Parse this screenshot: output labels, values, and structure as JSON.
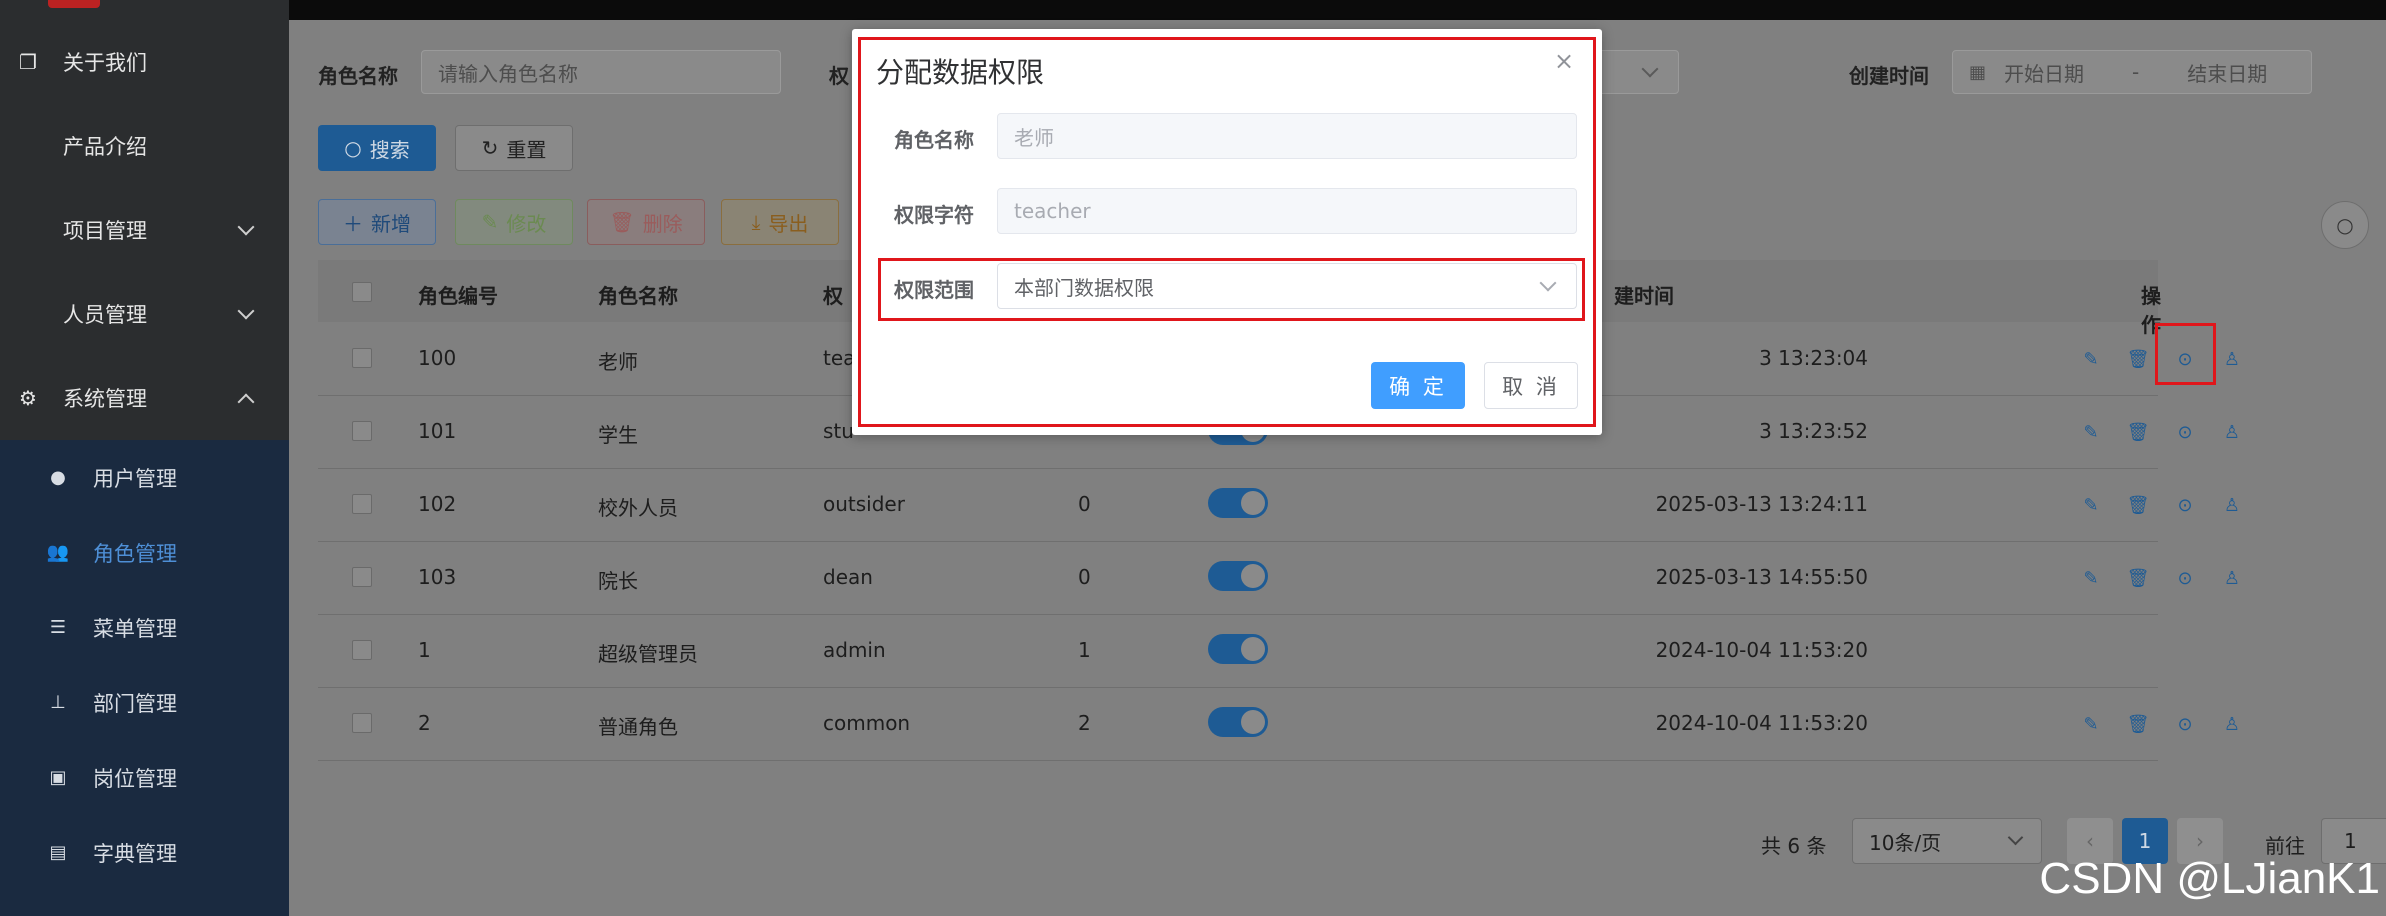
{
  "sidebar": {
    "items": [
      {
        "label": "关于我们",
        "icon": "file-copy-icon"
      },
      {
        "label": "产品介绍",
        "icon": ""
      },
      {
        "label": "项目管理",
        "icon": "",
        "expandable": true
      },
      {
        "label": "人员管理",
        "icon": "",
        "expandable": true
      },
      {
        "label": "系统管理",
        "icon": "gear-icon",
        "expandable": true,
        "expanded": true
      }
    ],
    "sub_items": [
      {
        "label": "用户管理",
        "icon": "user-icon"
      },
      {
        "label": "角色管理",
        "icon": "users-icon",
        "active": true
      },
      {
        "label": "菜单管理",
        "icon": "tree-list-icon"
      },
      {
        "label": "部门管理",
        "icon": "org-chart-icon"
      },
      {
        "label": "岗位管理",
        "icon": "post-icon"
      },
      {
        "label": "字典管理",
        "icon": "dictionary-icon"
      }
    ]
  },
  "filters": {
    "role_name_label": "角色名称",
    "role_name_placeholder": "请输入角色名称",
    "perm_label_partial": "权",
    "created_label": "创建时间",
    "start_date": "开始日期",
    "date_sep": "-",
    "end_date": "结束日期"
  },
  "toolbar": {
    "search": "搜索",
    "reset": "重置",
    "add": "新增",
    "edit": "修改",
    "delete": "删除",
    "export": "导出"
  },
  "table": {
    "headers": {
      "role_id": "角色编号",
      "role_name": "角色名称",
      "perm_key_partial": "权",
      "created_partial": "建时间",
      "ops": "操作"
    },
    "rows": [
      {
        "id": "100",
        "name": "老师",
        "key": "tea",
        "sort": "",
        "created": "3 13:23:04",
        "show_ops": true
      },
      {
        "id": "101",
        "name": "学生",
        "key": "stu",
        "sort": "",
        "created": "3 13:23:52",
        "show_ops": true
      },
      {
        "id": "102",
        "name": "校外人员",
        "key": "outsider",
        "sort": "0",
        "created": "2025-03-13 13:24:11",
        "show_ops": true
      },
      {
        "id": "103",
        "name": "院长",
        "key": "dean",
        "sort": "0",
        "created": "2025-03-13 14:55:50",
        "show_ops": true
      },
      {
        "id": "1",
        "name": "超级管理员",
        "key": "admin",
        "sort": "1",
        "created": "2024-10-04 11:53:20",
        "show_ops": false
      },
      {
        "id": "2",
        "name": "普通角色",
        "key": "common",
        "sort": "2",
        "created": "2024-10-04 11:53:20",
        "show_ops": true
      }
    ]
  },
  "pagination": {
    "total": "共 6 条",
    "page_size": "10条/页",
    "current": "1",
    "goto_label": "前往",
    "goto_value": "1"
  },
  "dialog": {
    "title": "分配数据权限",
    "close": "×",
    "role_name_label": "角色名称",
    "role_name_value": "老师",
    "perm_key_label": "权限字符",
    "perm_key_value": "teacher",
    "scope_label": "权限范围",
    "scope_value": "本部门数据权限",
    "ok": "确 定",
    "cancel": "取 消"
  },
  "watermark": "CSDN @LJianK1",
  "colors": {
    "primary": "#409eff",
    "highlight": "#e0161b",
    "sidebar_bg": "#2b2d2f",
    "submenu_bg": "#1a2a40"
  }
}
